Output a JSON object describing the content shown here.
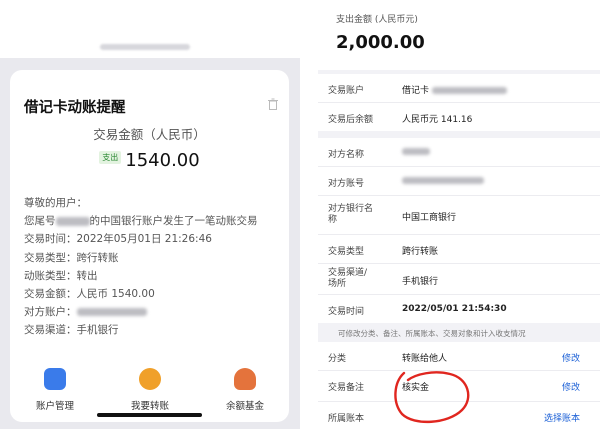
{
  "left_card": {
    "title": "借记卡动账提醒",
    "amount_label": "交易金额（人民币）",
    "badge": "支出",
    "amount": "1540.00",
    "lines": [
      "尊敬的用户：",
      "您尾号",
      "的中国银行账户发生了一笔动账交易",
      "交易时间：2022年05月01日 21:26:46",
      "交易类型：跨行转账",
      "动账类型：转出",
      "交易金额：人民币 1540.00",
      "对方账户：",
      "交易渠道：手机银行"
    ]
  },
  "bottom_nav": [
    {
      "label": "账户管理",
      "icon": "account-icon",
      "color": "#3a7bea"
    },
    {
      "label": "我要转账",
      "icon": "transfer-icon",
      "color": "#f0a02a"
    },
    {
      "label": "余额基金",
      "icon": "fund-icon",
      "color": "#e4733c"
    }
  ],
  "right_panel": {
    "amount_label": "支出金额 (人民币元)",
    "amount": "2,000.00",
    "group1": [
      {
        "k": "交易账户",
        "v": "借记卡"
      },
      {
        "k": "交易后余额",
        "v": "人民币元 141.16"
      }
    ],
    "group2": [
      {
        "k": "对方名称",
        "v": ""
      },
      {
        "k": "对方账号",
        "v": ""
      },
      {
        "k": "对方银行名称",
        "v": "中国工商银行"
      },
      {
        "k": "交易类型",
        "v": "跨行转账"
      },
      {
        "k": "交易渠道/场所",
        "v": "手机银行"
      },
      {
        "k": "交易时间",
        "v": "2022/05/01 21:54:30"
      }
    ],
    "hint": "可修改分类、备注、所属账本、交易对象和计入收支情况",
    "group3": [
      {
        "k": "分类",
        "v": "转账给他人",
        "act": "修改"
      },
      {
        "k": "交易备注",
        "v": "核实金",
        "act": "修改"
      },
      {
        "k": "所属账本",
        "v": "",
        "act": "选择账本"
      }
    ]
  },
  "colors": {
    "accent_link": "#1a5fd6",
    "annotation_red": "#e0261f",
    "badge_green": "#2d8a35"
  }
}
